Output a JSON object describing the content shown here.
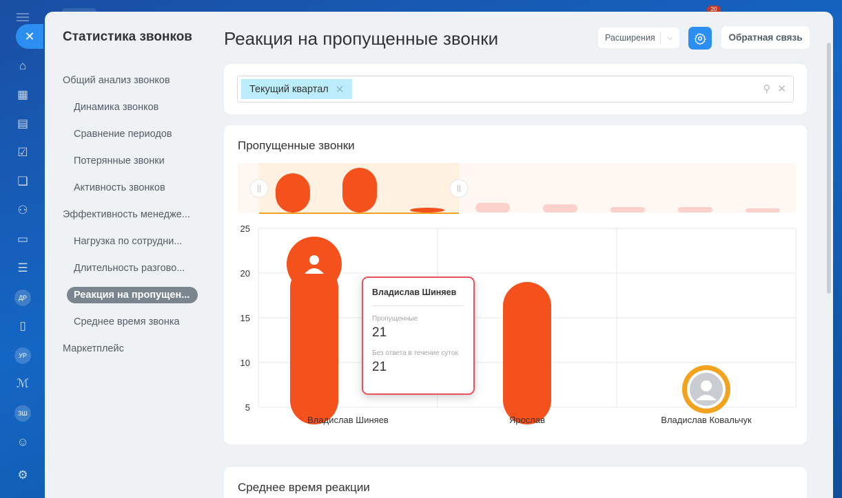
{
  "header": {
    "title": "Реакция на пропущенные звонки",
    "extensions_label": "Расширения",
    "feedback_label": "Обратная связь"
  },
  "sidebar": {
    "title": "Статистика звонков",
    "items": [
      {
        "label": "Общий анализ звонков",
        "level": 0
      },
      {
        "label": "Динамика звонков",
        "level": 1
      },
      {
        "label": "Сравнение периодов",
        "level": 1
      },
      {
        "label": "Потерянные звонки",
        "level": 1
      },
      {
        "label": "Активность звонков",
        "level": 1
      },
      {
        "label": "Эффективность менедже...",
        "level": 0
      },
      {
        "label": "Нагрузка по сотрудни...",
        "level": 1
      },
      {
        "label": "Длительность разгово...",
        "level": 1
      },
      {
        "label": "Реакция на пропущен...",
        "level": 1,
        "active": true
      },
      {
        "label": "Среднее время звонка",
        "level": 1
      },
      {
        "label": "Маркетплейс",
        "level": 0
      }
    ]
  },
  "rail": {
    "icons": [
      "menu-icon",
      "close-icon",
      "home-icon",
      "calendar-icon",
      "document-icon",
      "tasks-icon",
      "chat-icon",
      "contacts-icon",
      "cards-icon",
      "filter-icon",
      "avatar-dr",
      "file-icon",
      "avatar-ur",
      "signature-icon",
      "avatar-zsh",
      "robot-icon",
      "settings-icon"
    ],
    "avatars": {
      "dr": "ДР",
      "ur": "УР",
      "zsh": "ЗШ"
    },
    "notification_count": "20"
  },
  "filter": {
    "chip_label": "Текущий квартал"
  },
  "chart": {
    "title": "Пропущенные звонки",
    "accent": "#f5511d",
    "chart_data": {
      "type": "bar",
      "categories": [
        "Владислав Шиняев",
        "Ярослав",
        "Владислав Ковальчук"
      ],
      "series": [
        {
          "name": "Пропущенные",
          "values": [
            21,
            19,
            7
          ]
        }
      ],
      "ylim": [
        5,
        25
      ],
      "yticks": [
        5,
        10,
        15,
        20,
        25
      ],
      "grid": true
    }
  },
  "tooltip": {
    "name": "Владислав Шиняев",
    "missed_label": "Пропущенные",
    "missed_value": "21",
    "no_answer_label": "Без ответа в течение суток",
    "no_answer_value": "21"
  },
  "second_card": {
    "title": "Среднее время реакции"
  }
}
